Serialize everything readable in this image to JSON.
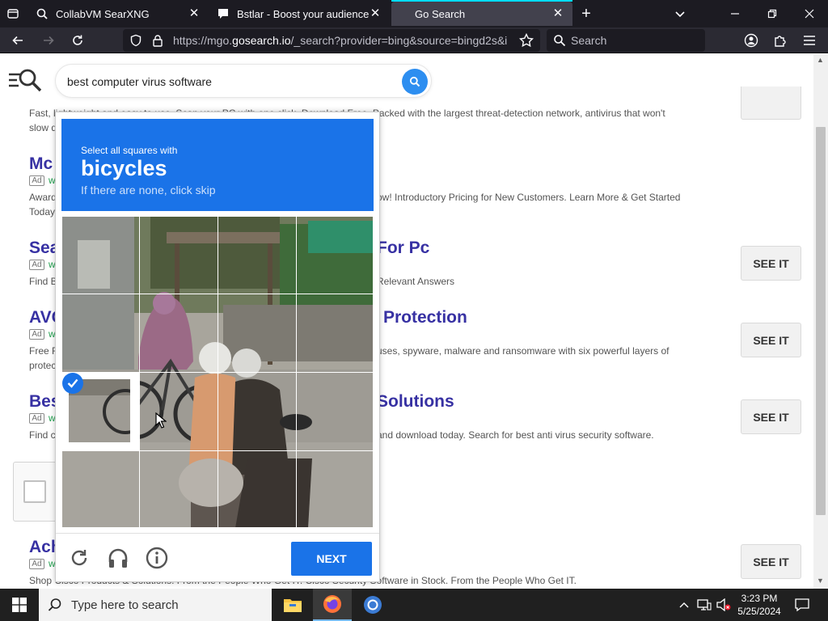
{
  "browser": {
    "tabs": [
      {
        "title": "CollabVM SearXNG",
        "icon": "searxng-icon",
        "active": false
      },
      {
        "title": "Bstlar - Boost your audience",
        "icon": "chat-bubble-icon",
        "active": false
      },
      {
        "title": "Go Search",
        "icon": "none",
        "active": true
      }
    ],
    "url_prefix": "https://mgo.",
    "url_domain": "gosearch.io",
    "url_suffix": "/_search?provider=bing&source=bingd2s&i",
    "search_placeholder": "Search"
  },
  "page": {
    "query": "best computer virus software",
    "results": [
      {
        "title": "",
        "snippet_line1": "Fast, lightweight and easy to use. Scan your PC with one click. Download Free. Packed with the largest threat-detection network, antivirus that won't",
        "snippet_line2": "slow down"
      },
      {
        "title": "Mc",
        "ad": "Ad",
        "url_stub": "w",
        "snippet_left_1": "Award",
        "snippet_left_2": "Today",
        "snippet_right": "ow! Introductory Pricing for New Customers. Learn More & Get Started"
      },
      {
        "title_left": "Sea",
        "title_right": "For Pc",
        "ad": "Ad",
        "url_stub": "w",
        "snippet_left": "Find B",
        "snippet_right": "Relevant Answers",
        "button": "SEE IT"
      },
      {
        "title_left": "AVC",
        "title_right": "Protection",
        "ad": "Ad",
        "url_stub": "w",
        "snippet_left_1": "Free F",
        "snippet_left_2": "protec",
        "snippet_right": "uses, spyware, malware and ransomware with six powerful layers of",
        "button": "SEE IT"
      },
      {
        "title_left": "Bes",
        "title_right": "Solutions",
        "ad": "Ad",
        "url_stub": "w",
        "snippet_left": "Find c",
        "snippet_right": "and download today. Search for best anti virus security software.",
        "button": "SEE IT"
      },
      {
        "title_left": "Ach",
        "ad": "Ad",
        "url_stub": "w",
        "snippet": "Shop Cisco Products & Solutions. From the People Who Get IT. Cisco Security Software in Stock. From the People Who Get IT.",
        "button": "SEE IT"
      }
    ]
  },
  "captcha": {
    "instruction": "Select all squares with",
    "target": "bicycles",
    "hint": "If there are none, click skip",
    "selected_tiles": [
      8
    ],
    "next_label": "NEXT",
    "accent": "#1a73e8"
  },
  "taskbar": {
    "search_placeholder": "Type here to search",
    "time": "3:23 PM",
    "date": "5/25/2024"
  }
}
